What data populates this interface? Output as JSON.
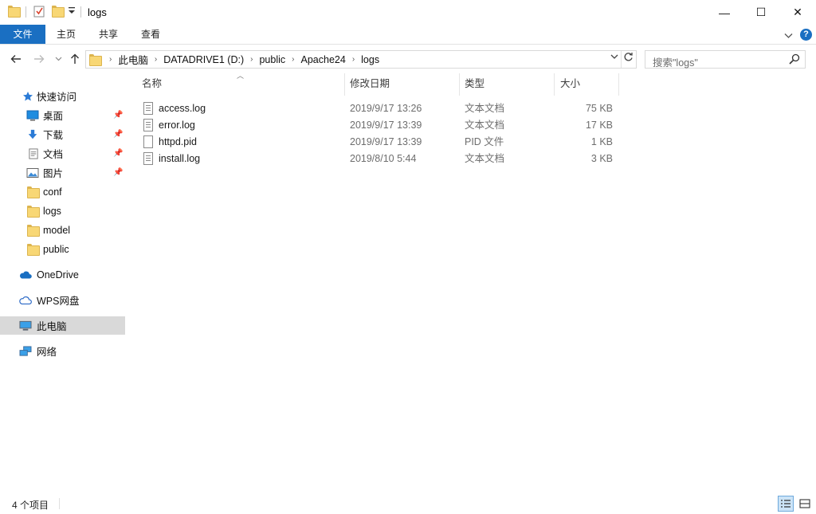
{
  "window": {
    "title": "logs",
    "controls": {
      "minimize": "—",
      "maximize": "☐",
      "close": "✕"
    }
  },
  "ribbon": {
    "tabs": [
      {
        "label": "文件",
        "active": true
      },
      {
        "label": "主页"
      },
      {
        "label": "共享"
      },
      {
        "label": "查看"
      }
    ],
    "collapse_icon": "chevron-down-icon",
    "help_label": "?"
  },
  "navigation": {
    "back_icon": "arrow-left-icon",
    "forward_icon": "arrow-right-icon",
    "recent_icon": "chevron-down-icon",
    "up_icon": "arrow-up-icon"
  },
  "address": {
    "breadcrumbs": [
      "此电脑",
      "DATADRIVE1 (D:)",
      "public",
      "Apache24",
      "logs"
    ]
  },
  "search": {
    "placeholder": "搜索\"logs\""
  },
  "sidebar": {
    "quick_access": {
      "label": "快速访问"
    },
    "pinned": [
      {
        "label": "桌面",
        "icon": "desktop-icon"
      },
      {
        "label": "下载",
        "icon": "download-icon"
      },
      {
        "label": "文档",
        "icon": "document-icon"
      },
      {
        "label": "图片",
        "icon": "pictures-icon"
      }
    ],
    "folders": [
      {
        "label": "conf"
      },
      {
        "label": "logs"
      },
      {
        "label": "model"
      },
      {
        "label": "public"
      }
    ],
    "locations": [
      {
        "label": "OneDrive",
        "icon": "onedrive-icon"
      },
      {
        "label": "WPS网盘",
        "icon": "cloud-icon"
      },
      {
        "label": "此电脑",
        "icon": "computer-icon",
        "selected": true
      },
      {
        "label": "网络",
        "icon": "network-icon"
      }
    ]
  },
  "file_list": {
    "columns": [
      "名称",
      "修改日期",
      "类型",
      "大小"
    ],
    "files": [
      {
        "name": "access.log",
        "modified": "2019/9/17 13:26",
        "type": "文本文档",
        "size": "75 KB"
      },
      {
        "name": "error.log",
        "modified": "2019/9/17 13:39",
        "type": "文本文档",
        "size": "17 KB"
      },
      {
        "name": "httpd.pid",
        "modified": "2019/9/17 13:39",
        "type": "PID 文件",
        "size": "1 KB"
      },
      {
        "name": "install.log",
        "modified": "2019/8/10 5:44",
        "type": "文本文档",
        "size": "3 KB"
      }
    ]
  },
  "status_bar": {
    "item_count": "4 个项目"
  },
  "colors": {
    "accent": "#1a6fc2",
    "folder": "#f8d775",
    "selected_nav": "#d9d9d9",
    "help": "#1a6fc2"
  }
}
